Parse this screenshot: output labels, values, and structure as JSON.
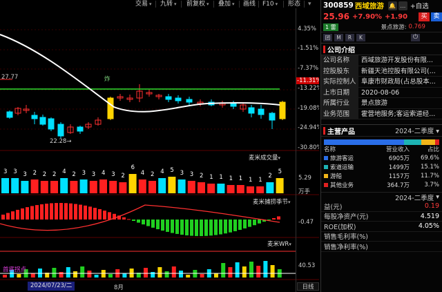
{
  "toolbar": {
    "items": [
      {
        "label": "交易",
        "caret": true
      },
      {
        "label": "九转",
        "caret": true
      },
      {
        "label": "前复权",
        "caret": true
      },
      {
        "label": "叠加",
        "caret": true
      },
      {
        "label": "画线",
        "caret": false
      },
      {
        "label": "F10",
        "caret": true
      },
      {
        "label": "形态",
        "caret": false
      }
    ]
  },
  "chart": {
    "pct_labels": [
      "4.35%",
      "-1.51%",
      "-7.37%",
      "-11.31%",
      "-13.22%",
      "-19.08%",
      "-24.94%",
      "-30.80%"
    ],
    "price_marks": {
      "left_high": "27.77",
      "low": "22.28",
      "marker": "炸"
    },
    "volume": {
      "panel_title": "麦米成交量",
      "value": "5.29",
      "unit": "万手",
      "counts": [
        "3",
        "3",
        "3",
        "2",
        "2",
        "2",
        "4",
        "2",
        "3",
        "3",
        "4",
        "3",
        "2",
        "6",
        "4",
        "2",
        "4",
        "5",
        "3",
        "3",
        "2",
        "1",
        "1",
        "1",
        "1",
        "1",
        "1",
        "2",
        "5"
      ]
    },
    "seasonal": {
      "panel_title": "麦米捕捞季节",
      "value": "-0.47"
    },
    "wr": {
      "panel_title": "麦米WR",
      "value": "40.53",
      "caption": "首底拐点"
    },
    "date_chip": "2024/07/23/二",
    "month_label": "8月",
    "period_button": "日线"
  },
  "side": {
    "code": "300859",
    "name": "西域旅游",
    "self_select": "+自选",
    "price": "25.96",
    "change_pct": "+7.90%",
    "change": "+1.90",
    "buy": "买",
    "sell": "卖",
    "board_badge": "1 雷",
    "sub_label": "景点旅游:",
    "sub_value": "0.769",
    "tabs": [
      "团",
      "M",
      "R",
      "K"
    ],
    "company_section": "公司介绍",
    "company_info": [
      {
        "k": "公司名称",
        "v": "西域旅游开发股份有限..."
      },
      {
        "k": "控股股东",
        "v": "新疆天池控股有限公司(..."
      },
      {
        "k": "实际控制人",
        "v": "阜康市财政局(占总股本..."
      },
      {
        "k": "上市日期",
        "v": "2020-08-06"
      },
      {
        "k": "所属行业",
        "v": "景点旅游"
      },
      {
        "k": "业务范围",
        "v": "霍营地服务;客运索道经..."
      }
    ],
    "product_section": "主营产品",
    "product_period": "2024-二季度",
    "product_headers": [
      "名称",
      "营业收入",
      "占比"
    ],
    "products": [
      {
        "name": "旅游客运",
        "revenue": "6905万",
        "share": "69.6%",
        "color": "#2a6ee8"
      },
      {
        "name": "索道运输",
        "revenue": "1499万",
        "share": "15.1%",
        "color": "#1db3b3"
      },
      {
        "name": "游船",
        "revenue": "1157万",
        "share": "11.7%",
        "color": "#f0b419"
      },
      {
        "name": "其他业务",
        "revenue": "364.7万",
        "share": "3.7%",
        "color": "#e02020"
      }
    ],
    "fin_period": "2024-二季度",
    "fin_rows": [
      {
        "k": "益(元)",
        "v": "0.19",
        "red": true
      },
      {
        "k": "每股净资产(元)",
        "v": "4.519",
        "red": false
      },
      {
        "k": "ROE(加权)",
        "v": "4.05%",
        "red": false
      },
      {
        "k": "销售毛利率(%)",
        "v": "",
        "red": false
      },
      {
        "k": "销售净利率(%)",
        "v": "",
        "red": false
      }
    ]
  }
}
